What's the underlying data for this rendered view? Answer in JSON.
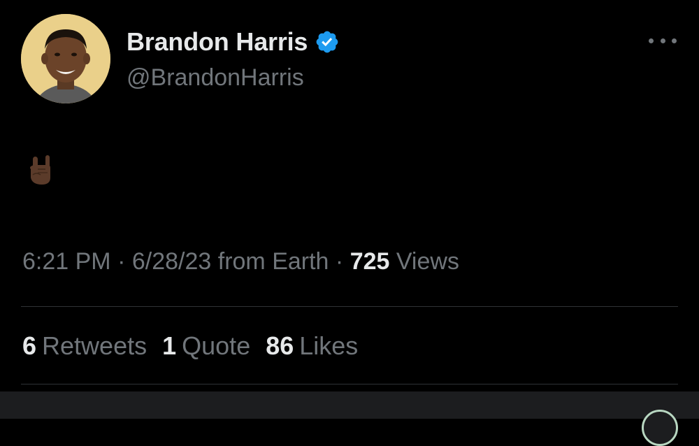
{
  "author": {
    "display_name": "Brandon Harris",
    "handle": "@BrandonHarris",
    "verified": true,
    "avatar_icon": "profile-photo"
  },
  "menu": {
    "more_icon": "more-horizontal-icon"
  },
  "tweet": {
    "content_emoji": "🤘🏿",
    "content_icon": "sign-of-horns-icon"
  },
  "meta": {
    "time": "6:21 PM",
    "separator1": " · ",
    "date": "6/28/23",
    "source": " from Earth",
    "separator2": " · ",
    "views_count": "725",
    "views_label": " Views"
  },
  "stats": {
    "retweets_count": "6",
    "retweets_label": "Retweets",
    "quotes_count": "1",
    "quotes_label": "Quote",
    "likes_count": "86",
    "likes_label": "Likes"
  },
  "colors": {
    "background": "#000000",
    "primary_text": "#e7e9ea",
    "secondary_text": "#71767b",
    "verified_blue": "#1d9bf0",
    "divider": "#2f3336"
  }
}
